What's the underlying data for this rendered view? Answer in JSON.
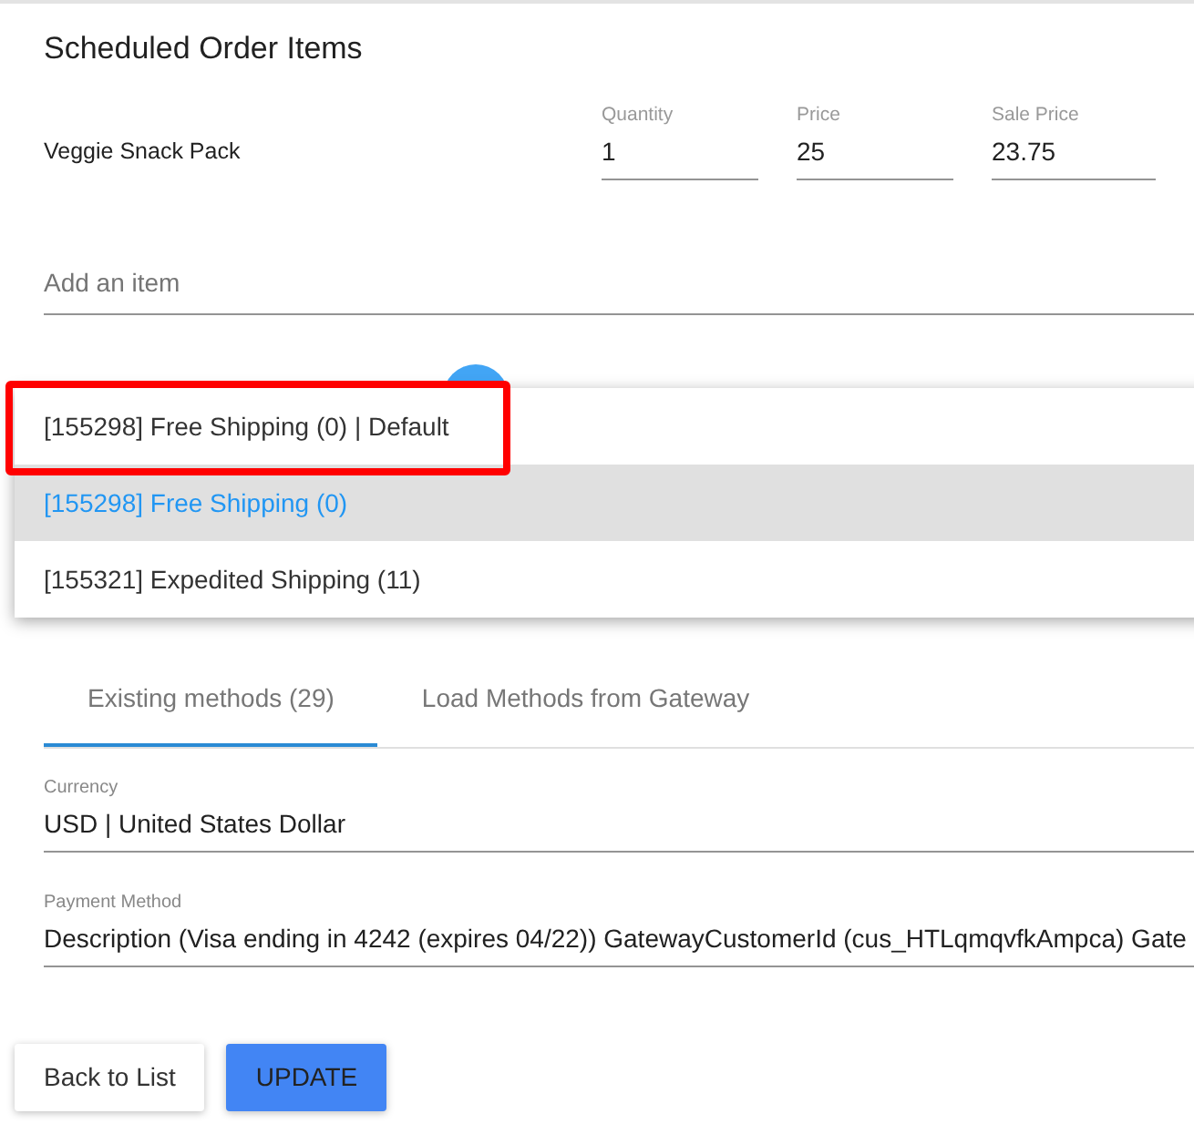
{
  "section_title": "Scheduled Order Items",
  "items": [
    {
      "name": "Veggie Snack Pack",
      "fields": [
        {
          "label": "Quantity",
          "value": "1"
        },
        {
          "label": "Price",
          "value": "25"
        },
        {
          "label": "Sale Price",
          "value": "23.75"
        }
      ]
    }
  ],
  "add_item": {
    "placeholder": "Add an item"
  },
  "dropdown": {
    "options": [
      {
        "label": "[155298] Free Shipping (0) | Default",
        "selected": false,
        "highlighted": true
      },
      {
        "label": "[155298] Free Shipping (0)",
        "selected": true,
        "highlighted": false
      },
      {
        "label": "[155321] Expedited Shipping (11)",
        "selected": false,
        "highlighted": false
      }
    ]
  },
  "tabs": [
    {
      "label": "Existing methods (29)",
      "selected": true
    },
    {
      "label": "Load Methods from Gateway",
      "selected": false
    }
  ],
  "fields": [
    {
      "label": "Currency",
      "value": "USD | United States Dollar"
    },
    {
      "label": "Payment Method",
      "value": "Description (Visa ending in 4242 (expires 04/22)) GatewayCustomerId (cus_HTLqmqvfkAmpca) Gate"
    }
  ],
  "buttons": [
    {
      "label": "Back to List",
      "kind": "plain"
    },
    {
      "label": "UPDATE",
      "kind": "primary"
    }
  ]
}
